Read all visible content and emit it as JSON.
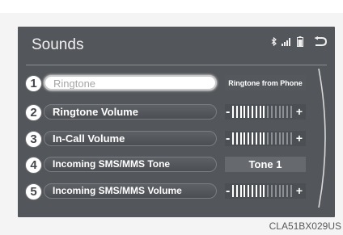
{
  "header": {
    "title": "Sounds",
    "status_icons": [
      "bluetooth-icon",
      "signal-bars-icon",
      "battery-icon"
    ],
    "back_icon": "back-arrow-icon"
  },
  "rows": [
    {
      "number": "1",
      "label": "Ringtone",
      "selected": true,
      "control": "text",
      "value": "Ringtone from Phone"
    },
    {
      "number": "2",
      "label": "Ringtone Volume",
      "selected": false,
      "control": "volume",
      "minus": "-",
      "plus": "+",
      "level": 0.55
    },
    {
      "number": "3",
      "label": "In-Call Volume",
      "selected": false,
      "control": "volume",
      "minus": "-",
      "plus": "+",
      "level": 0.55
    },
    {
      "number": "4",
      "label": "Incoming SMS/MMS Tone",
      "selected": false,
      "control": "text",
      "value": "Tone 1"
    },
    {
      "number": "5",
      "label": "Incoming SMS/MMS Volume",
      "selected": false,
      "control": "volume",
      "minus": "-",
      "plus": "+",
      "level": 0.55
    }
  ],
  "figure_code": "CLA51BX029US",
  "colors": {
    "screen_bg": "#53565a",
    "bar_active": "#ffffff",
    "bar_inactive": "#8d9094"
  }
}
